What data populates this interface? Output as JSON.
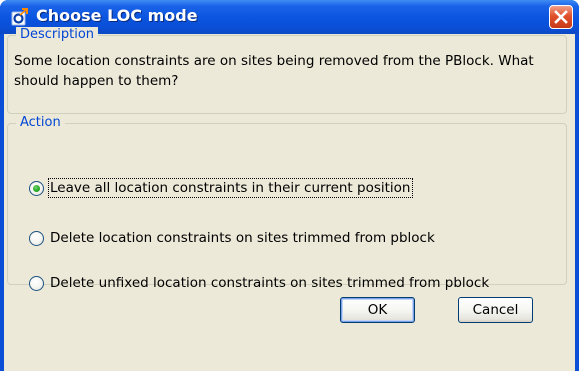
{
  "window": {
    "title": "Choose LOC mode",
    "icon": "tcl-app-icon",
    "close_icon": "close-icon"
  },
  "description": {
    "legend": "Description",
    "text": "Some location constraints are on sites being removed from the PBlock. What should happen to them?"
  },
  "action": {
    "legend": "Action",
    "options": [
      {
        "label": "Leave all location constraints in their current position",
        "selected": true
      },
      {
        "label": "Delete location constraints on sites trimmed from pblock",
        "selected": false
      },
      {
        "label": "Delete unfixed location constraints on sites trimmed from pblock",
        "selected": false
      }
    ]
  },
  "buttons": {
    "ok": "OK",
    "cancel": "Cancel"
  },
  "colors": {
    "titlebar": "#0a4fd6",
    "dialog_face": "#ece9d8",
    "group_legend": "#0046d5",
    "close_button": "#e0522b"
  }
}
